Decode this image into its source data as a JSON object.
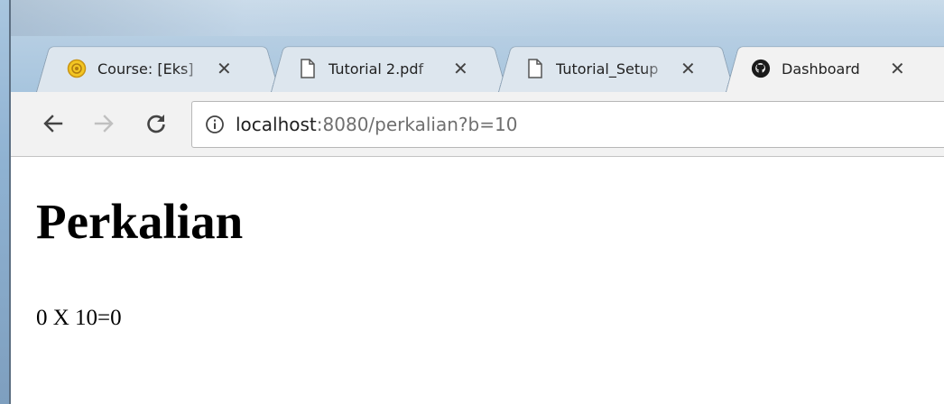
{
  "browser": {
    "tabs": [
      {
        "title": "Course: [Eks]",
        "icon": "moodle-logo-icon",
        "active": false
      },
      {
        "title": "Tutorial 2.pdf",
        "icon": "document-icon",
        "active": false
      },
      {
        "title": "Tutorial_Setup",
        "icon": "document-icon",
        "active": false
      },
      {
        "title": "Dashboard",
        "icon": "github-icon",
        "active": true
      }
    ],
    "close_glyph": "✕",
    "address": {
      "host": "localhost",
      "rest": ":8080/perkalian?b=10"
    }
  },
  "page": {
    "heading": "Perkalian",
    "result": "0 X 10=0"
  }
}
